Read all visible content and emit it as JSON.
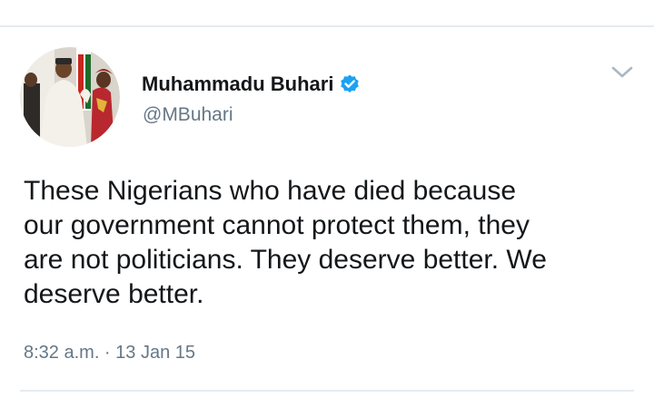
{
  "user": {
    "display_name": "Muhammadu Buhari",
    "handle": "@MBuhari",
    "verified": true,
    "verified_icon": "verified-badge-icon",
    "avatar_icon": "profile-photo"
  },
  "tweet": {
    "lines": [
      "These Nigerians who have died because",
      "our government cannot protect them, they",
      "are not politicians. They deserve better. We",
      "deserve better."
    ],
    "timestamp": "8:32 a.m. · 13 Jan 15"
  },
  "menu": {
    "icon": "chevron-down-icon"
  },
  "colors": {
    "text": "#14171a",
    "secondary_text": "#657786",
    "verified_blue": "#1da1f2",
    "divider": "#e6ecf0"
  }
}
